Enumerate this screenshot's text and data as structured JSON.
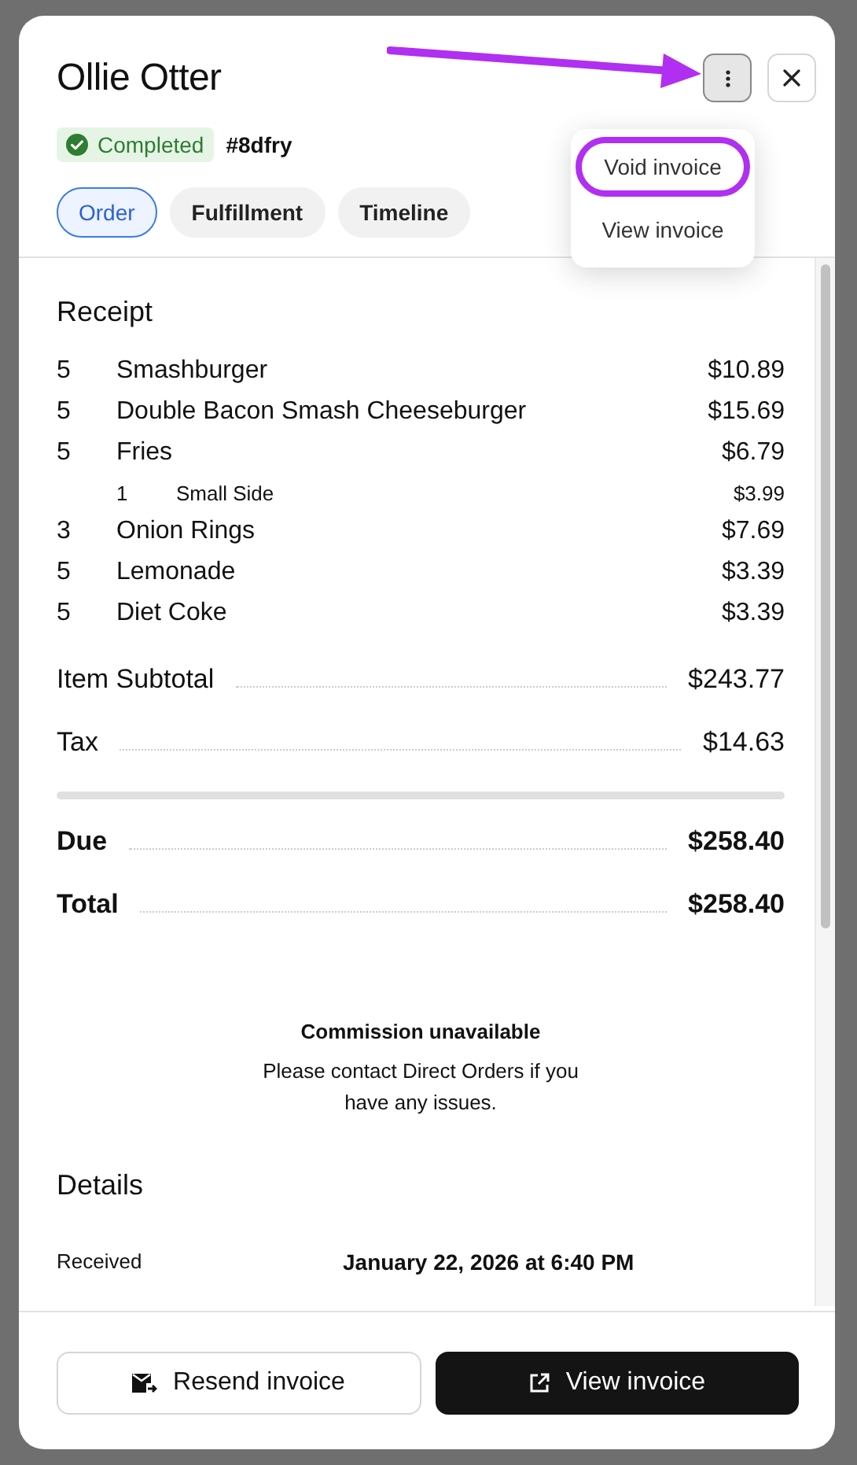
{
  "dialog": {
    "title": "Ollie Otter",
    "status": {
      "label": "Completed",
      "kind": "success"
    },
    "order_number": "#8dfry"
  },
  "tabs": [
    {
      "label": "Order",
      "selected": true
    },
    {
      "label": "Fulfillment",
      "selected": false
    },
    {
      "label": "Timeline",
      "selected": false
    }
  ],
  "menu": {
    "items": [
      {
        "label": "Void invoice",
        "highlighted": true
      },
      {
        "label": "View invoice",
        "highlighted": false
      }
    ]
  },
  "receipt": {
    "title": "Receipt",
    "items": [
      {
        "qty": "5",
        "name": "Smashburger",
        "price": "$10.89"
      },
      {
        "qty": "5",
        "name": "Double Bacon Smash Cheeseburger",
        "price": "$15.69"
      },
      {
        "qty": "5",
        "name": "Fries",
        "price": "$6.79",
        "children": [
          {
            "qty": "1",
            "name": "Small Side",
            "price": "$3.99"
          }
        ]
      },
      {
        "qty": "3",
        "name": "Onion Rings",
        "price": "$7.69"
      },
      {
        "qty": "5",
        "name": "Lemonade",
        "price": "$3.39"
      },
      {
        "qty": "5",
        "name": "Diet Coke",
        "price": "$3.39"
      }
    ],
    "subtotals": [
      {
        "label": "Item Subtotal",
        "value": "$243.77"
      },
      {
        "label": "Tax",
        "value": "$14.63"
      }
    ],
    "totals": [
      {
        "label": "Due",
        "value": "$258.40"
      },
      {
        "label": "Total",
        "value": "$258.40"
      }
    ]
  },
  "notice": {
    "title": "Commission unavailable",
    "text": "Please contact Direct Orders if you have any issues."
  },
  "details": {
    "title": "Details",
    "rows": [
      {
        "label": "Received",
        "value": "January 22, 2026 at 6:40 PM"
      }
    ]
  },
  "footer": {
    "buttons": [
      {
        "label": "Resend invoice",
        "kind": "secondary"
      },
      {
        "label": "View invoice",
        "kind": "primary"
      }
    ]
  }
}
